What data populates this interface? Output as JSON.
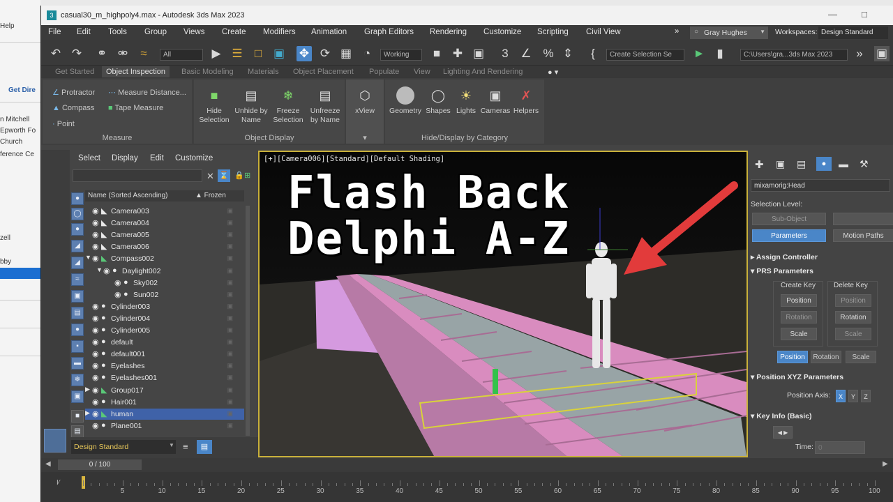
{
  "background_app": {
    "items": [
      "Help",
      "Get Dire",
      "n Mitchell",
      "Epworth Fo",
      "Church",
      "ference Ce",
      "zell",
      "bby"
    ]
  },
  "window": {
    "title": "casual30_m_highpoly4.max - Autodesk 3ds Max 2023"
  },
  "menubar": {
    "items": [
      "File",
      "Edit",
      "Tools",
      "Group",
      "Views",
      "Create",
      "Modifiers",
      "Animation",
      "Graph Editors",
      "Rendering",
      "Customize",
      "Scripting",
      "Civil View"
    ],
    "user": "Gray Hughes",
    "workspaces_label": "Workspaces:",
    "workspace_value": "Design Standard"
  },
  "toolbar": {
    "filter_value": "All",
    "coord_value": "Working",
    "selection_set_placeholder": "Create Selection Se",
    "path_value": "C:\\Users\\gra...3ds Max 2023"
  },
  "ribbon": {
    "tabs": [
      "Get Started",
      "Object Inspection",
      "Basic Modeling",
      "Materials",
      "Object Placement",
      "Populate",
      "View",
      "Lighting And Rendering"
    ],
    "active_tab": "Object Inspection",
    "measure": {
      "items": [
        "Protractor",
        "Compass",
        "Point",
        "Measure Distance...",
        "Tape Measure"
      ],
      "label": "Measure"
    },
    "object_display": {
      "buttons": [
        "Hide\nSelection",
        "Unhide by\nName",
        "Freeze\nSelection",
        "Unfreeze\nby Name"
      ],
      "label": "Object Display"
    },
    "xview": {
      "label": "xView"
    },
    "hide_display": {
      "buttons": [
        "Geometry",
        "Shapes",
        "Lights",
        "Cameras",
        "Helpers"
      ],
      "label": "Hide/Display by Category"
    }
  },
  "explorer": {
    "tabs": [
      "Select",
      "Display",
      "Edit",
      "Customize"
    ],
    "col_name": "Name (Sorted Ascending)",
    "col_frozen": "▲ Frozen",
    "rows": [
      {
        "name": "Camera003",
        "indent": 0,
        "type": "camera"
      },
      {
        "name": "Camera004",
        "indent": 0,
        "type": "camera"
      },
      {
        "name": "Camera005",
        "indent": 0,
        "type": "camera"
      },
      {
        "name": "Camera006",
        "indent": 0,
        "type": "camera"
      },
      {
        "name": "Compass002",
        "indent": 0,
        "type": "helper",
        "expanded": true
      },
      {
        "name": "Daylight002",
        "indent": 1,
        "type": "light",
        "expanded": true
      },
      {
        "name": "Sky002",
        "indent": 2,
        "type": "light"
      },
      {
        "name": "Sun002",
        "indent": 2,
        "type": "light"
      },
      {
        "name": "Cylinder003",
        "indent": 0,
        "type": "geo"
      },
      {
        "name": "Cylinder004",
        "indent": 0,
        "type": "geo"
      },
      {
        "name": "Cylinder005",
        "indent": 0,
        "type": "geo"
      },
      {
        "name": "default",
        "indent": 0,
        "type": "geo"
      },
      {
        "name": "default001",
        "indent": 0,
        "type": "geo"
      },
      {
        "name": "Eyelashes",
        "indent": 0,
        "type": "geo"
      },
      {
        "name": "Eyelashes001",
        "indent": 0,
        "type": "geo"
      },
      {
        "name": "Group017",
        "indent": 0,
        "type": "group",
        "collapsed": true
      },
      {
        "name": "Hair001",
        "indent": 0,
        "type": "geo"
      },
      {
        "name": "human",
        "indent": 0,
        "type": "group",
        "collapsed": true,
        "selected": true
      },
      {
        "name": "Plane001",
        "indent": 0,
        "type": "geo"
      }
    ],
    "workspace_value": "Design Standard"
  },
  "viewport": {
    "label": "[+][Camera006][Standard][Default Shading]",
    "overlay_line1": "Flash Back",
    "overlay_line2": "Delphi A-Z",
    "arrow_color": "#e23b3b",
    "road_color": "#d98cbf"
  },
  "command_panel": {
    "object_name": "mixamorig:Head",
    "selection_level": "Selection Level:",
    "sub_object": "Sub-Object",
    "parameters": "Parameters",
    "motion_paths": "Motion Paths",
    "assign_controller": "Assign Controller",
    "prs_parameters": "PRS Parameters",
    "create_key": "Create Key",
    "delete_key": "Delete Key",
    "position": "Position",
    "rotation": "Rotation",
    "scale": "Scale",
    "position_xyz": "Position XYZ Parameters",
    "position_axis": "Position Axis:",
    "axes": [
      "X",
      "Y",
      "Z"
    ],
    "key_info": "Key Info (Basic)",
    "time_label": "Time:",
    "time_value": "0"
  },
  "timeline": {
    "slider": "0 / 100",
    "ticks": [
      "5",
      "10",
      "15",
      "20",
      "25",
      "30",
      "35",
      "40",
      "45",
      "50",
      "55",
      "60",
      "65",
      "70",
      "75",
      "80",
      "85",
      "90",
      "95",
      "100"
    ]
  }
}
